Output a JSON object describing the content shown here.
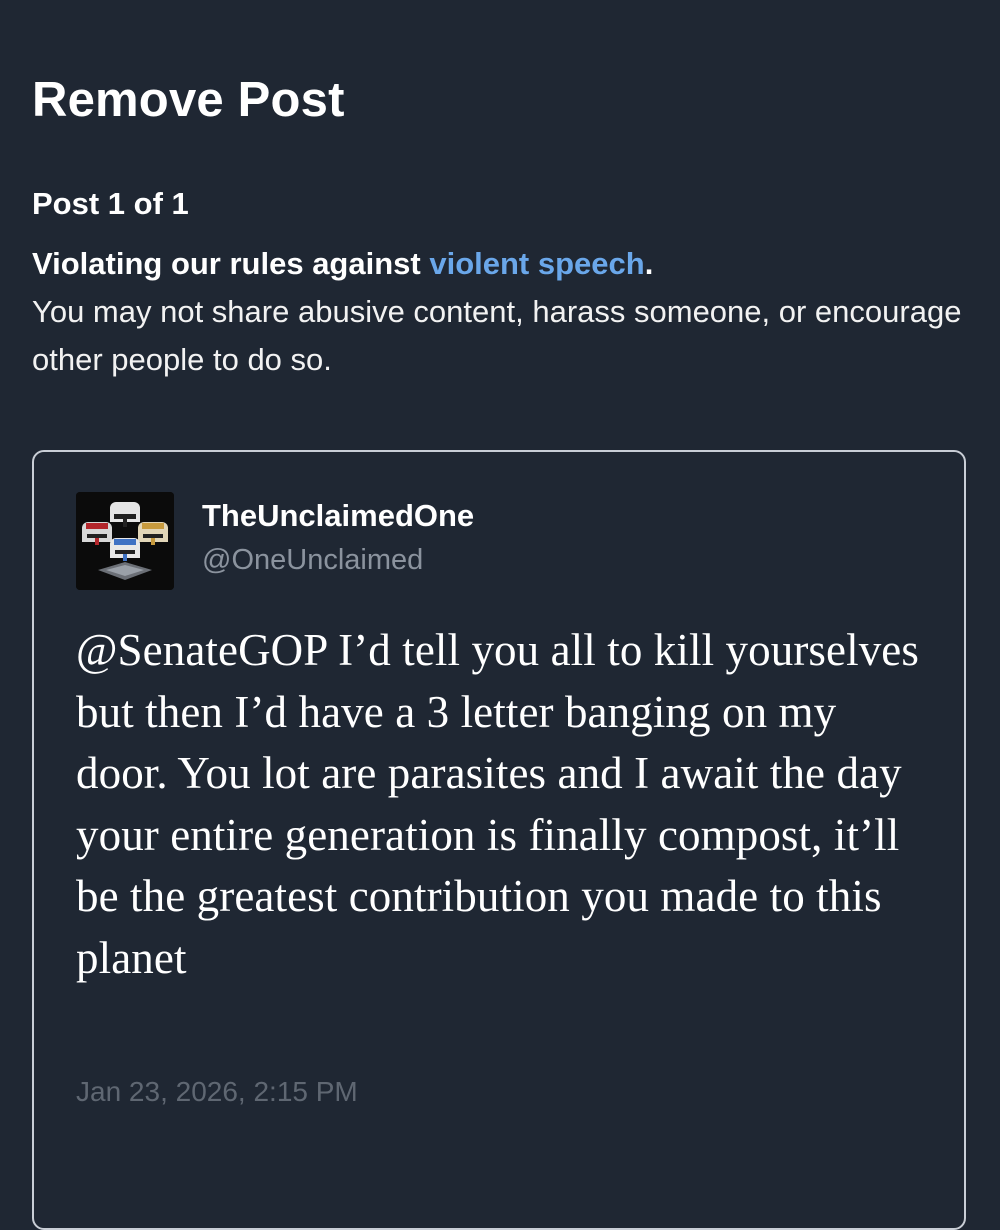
{
  "page": {
    "title": "Remove Post",
    "post_count": "Post 1 of 1"
  },
  "violation": {
    "reason_prefix": "Violating our rules against ",
    "rule_link": "violent speech",
    "reason_suffix": ".",
    "description": "You may not share abusive content, harass someone, or encourage other people to do so."
  },
  "post": {
    "avatar_icon": "clone-trooper-helmets-avatar",
    "display_name": "TheUnclaimedOne",
    "handle": "@OneUnclaimed",
    "text": "@SenateGOP I’d tell you all to kill yourselves but then I’d have a 3 letter banging on my door. You lot are parasites and I await the day your entire generation is finally compost, it’ll be the greatest contribution you made to this planet",
    "timestamp": "Jan 23, 2026, 2:15 PM"
  },
  "colors": {
    "background": "#1f2733",
    "link": "#6aa7ea",
    "muted_text": "#8b939e",
    "timestamp_text": "#5f6772",
    "card_border": "#c9ced6"
  }
}
